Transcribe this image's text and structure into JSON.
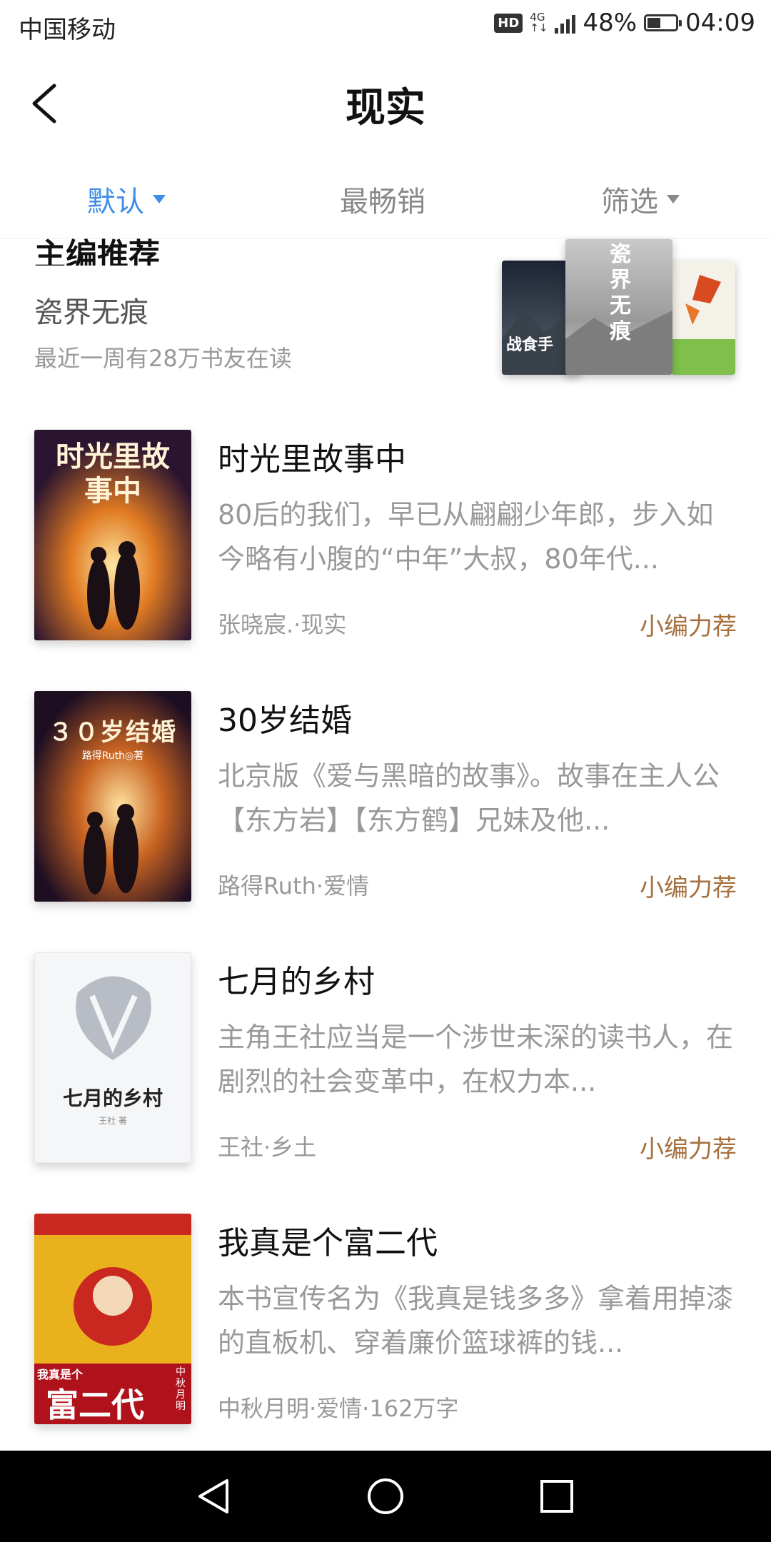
{
  "status_bar": {
    "carrier": "中国移动",
    "hd": "HD",
    "network": "4G",
    "network_sub": "↑↓",
    "battery": "48%",
    "time": "04:09",
    "battery_level": 0.48
  },
  "header": {
    "title": "现实"
  },
  "tabs": [
    {
      "label": "默认",
      "has_caret": true,
      "active": true
    },
    {
      "label": "最畅销",
      "has_caret": false,
      "active": false
    },
    {
      "label": "筛选",
      "has_caret": true,
      "active": false
    }
  ],
  "editor_pick": {
    "heading": "主编推荐",
    "book_title": "瓷界无痕",
    "readers": "最近一周有28万书友在读",
    "covers": [
      {
        "title": "战食手",
        "side": "left"
      },
      {
        "title": "瓷界无痕",
        "side": "center"
      },
      {
        "title": "",
        "side": "right"
      }
    ]
  },
  "books": [
    {
      "title": "时光里故事中",
      "cover_text": "时光里故事中",
      "description": "80后的我们，早已从翩翩少年郎，步入如今略有小腹的“中年”大叔，80年代...",
      "meta": "张晓宸.·现实",
      "tag": "小编力荐"
    },
    {
      "title": "30岁结婚",
      "cover_text": "３０岁结婚",
      "cover_author": "路得Ruth◎著",
      "description": "北京版《爱与黑暗的故事》。故事在主人公【东方岩】【东方鹤】兄妹及他...",
      "meta": "路得Ruth·爱情",
      "tag": "小编力荐"
    },
    {
      "title": "七月的乡村",
      "cover_text": "七月的乡村",
      "cover_author": "王社 著",
      "description": "主角王社应当是一个涉世未深的读书人，在剧烈的社会变革中，在权力本...",
      "meta": "王社·乡土",
      "tag": "小编力荐"
    },
    {
      "title": "我真是个富二代",
      "cover_text": "富二代",
      "cover_small": "我真是个",
      "cover_side": "中秋月明",
      "description": "本书宣传名为《我真是钱多多》拿着用掉漆的直板机、穿着廉价篮球裤的钱...",
      "meta": "中秋月明·爱情·162万字",
      "tag": ""
    }
  ],
  "colors": {
    "accent": "#3e8ee6",
    "tag": "#a5703e"
  }
}
